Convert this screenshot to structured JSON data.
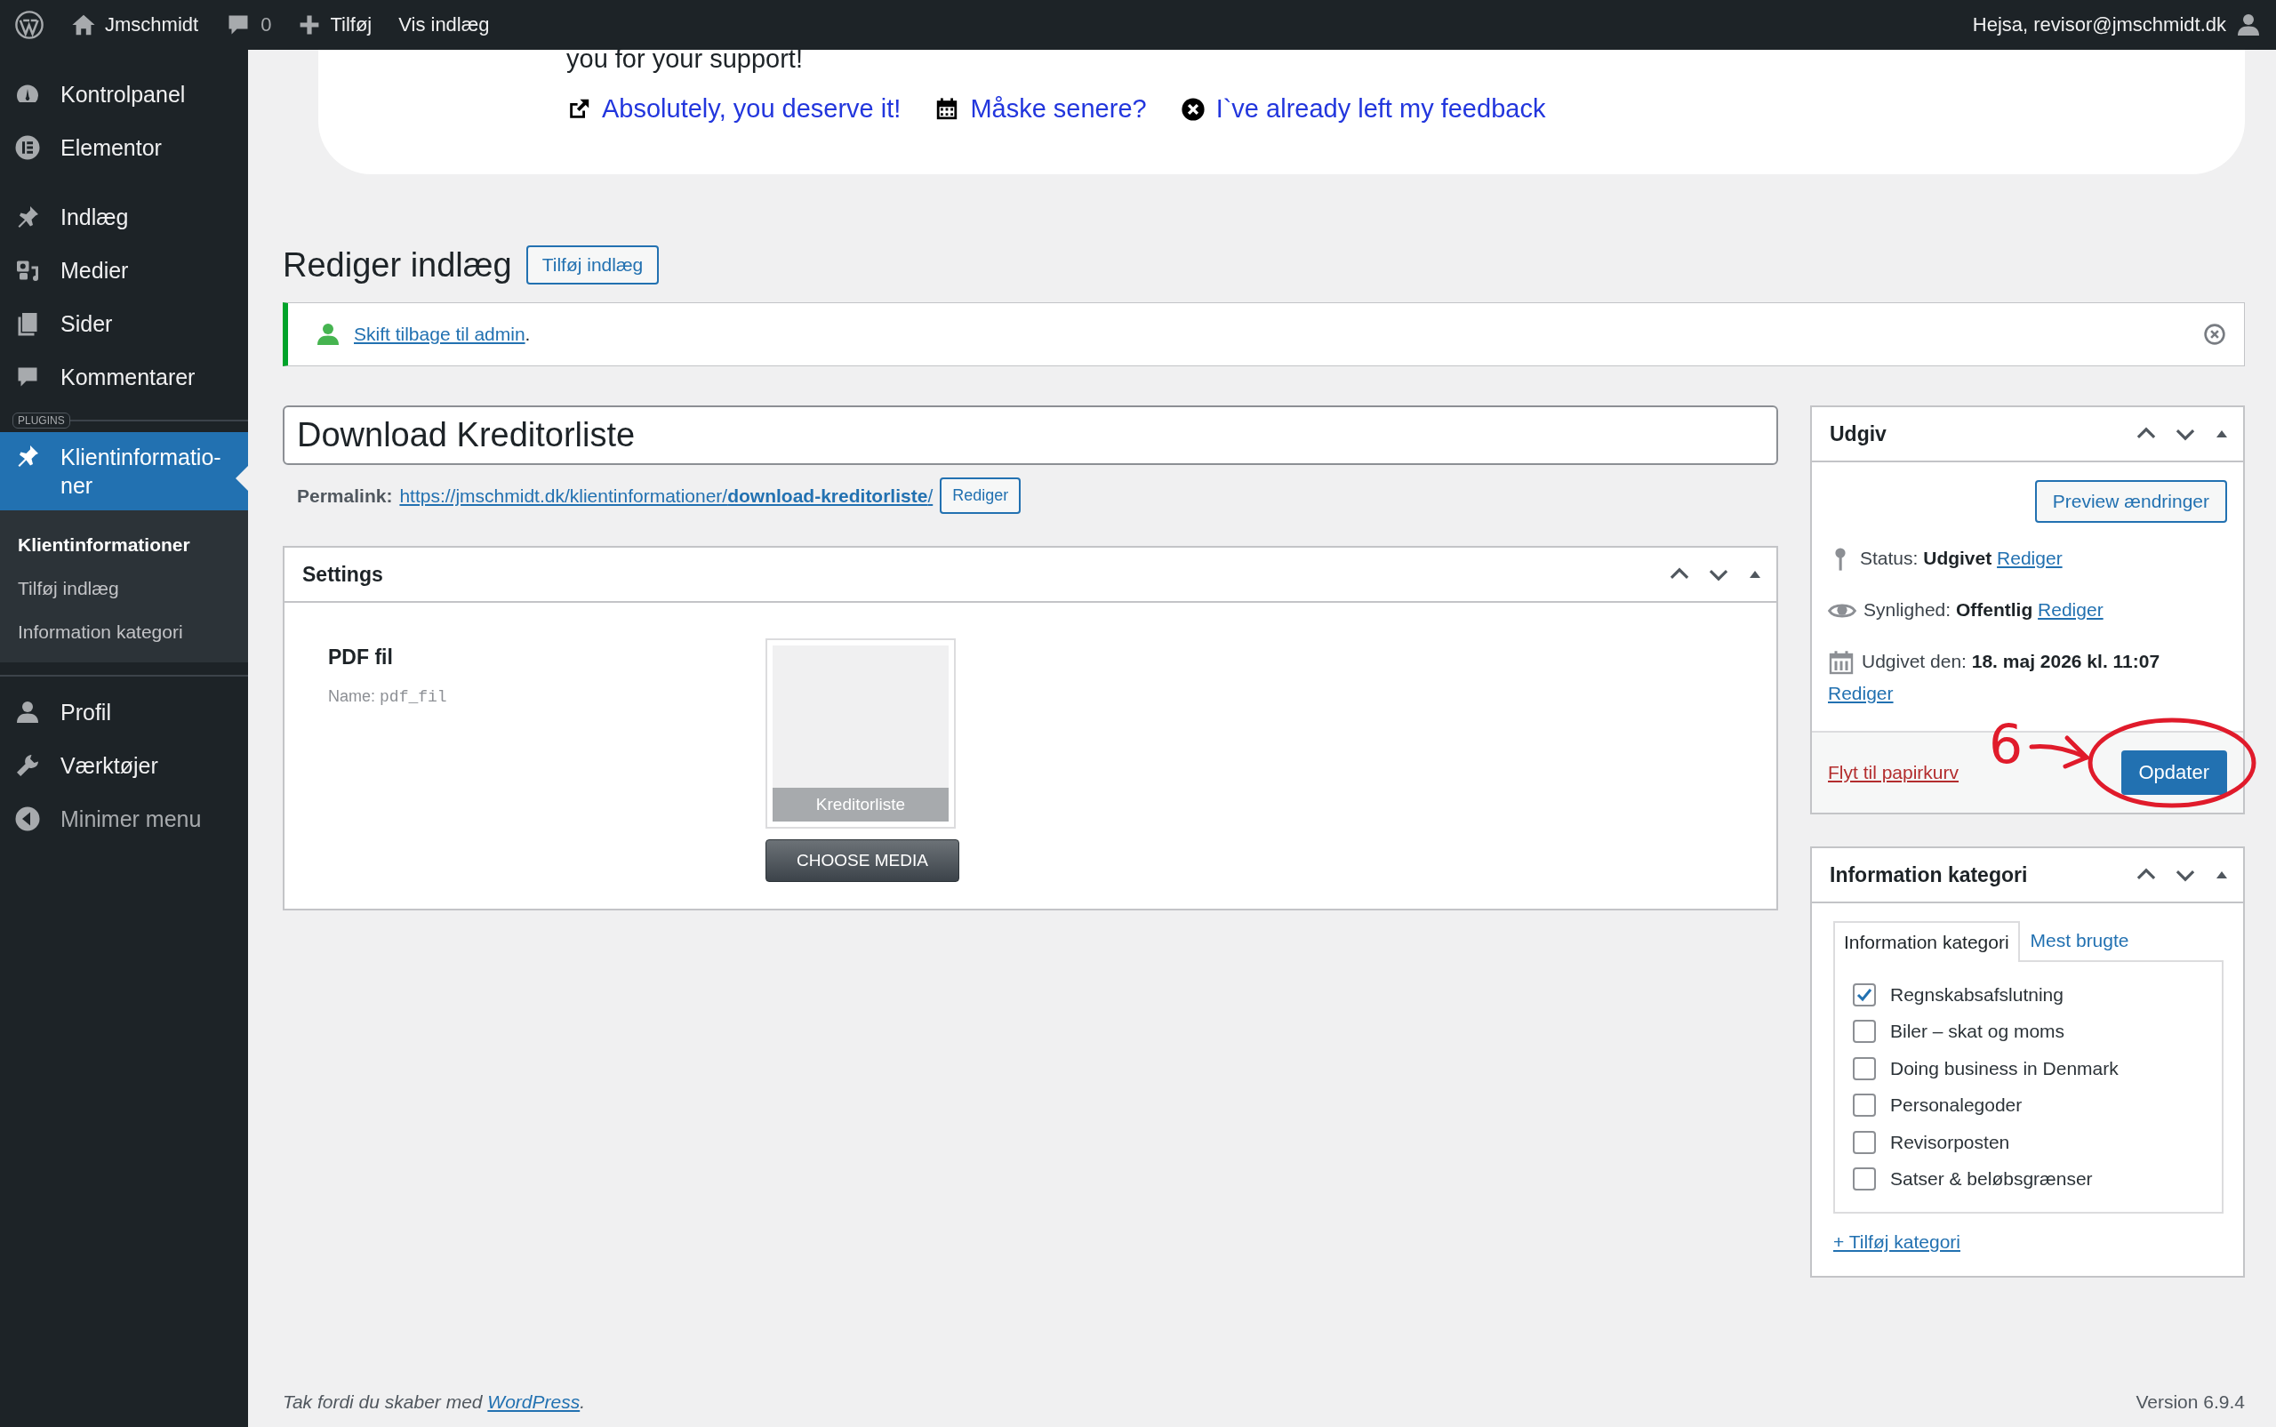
{
  "admin_bar": {
    "site": "Jmschmidt",
    "comments": "0",
    "new": "Tilføj",
    "view": "Vis indlæg",
    "greeting": "Hejsa, revisor@jmschmidt.dk"
  },
  "sidebar": {
    "items": [
      {
        "label": "Kontrolpanel",
        "selected": false
      },
      {
        "label": "Elementor",
        "selected": false
      },
      {
        "label": "Indlæg",
        "selected": false
      },
      {
        "label": "Medier",
        "selected": false
      },
      {
        "label": "Sider",
        "selected": false
      },
      {
        "label": "Kommentarer",
        "selected": false
      }
    ],
    "section_label": "PLUGINS",
    "plugin_items": [
      {
        "label": "Klientinformatio-ner",
        "selected": true
      }
    ],
    "submenu": [
      {
        "label": "Klientinformationer",
        "selected": true
      },
      {
        "label": "Tilføj indlæg",
        "selected": false
      },
      {
        "label": "Information kategori",
        "selected": false
      }
    ],
    "bottom_items": [
      {
        "label": "Profil",
        "selected": false
      },
      {
        "label": "Værktøjer",
        "selected": false
      },
      {
        "label": "Minimer menu",
        "selected": false
      }
    ]
  },
  "feedback_notice": {
    "text": "you for your support!",
    "links": [
      {
        "kind": "external",
        "label": "Absolutely, you deserve it!"
      },
      {
        "kind": "calendar",
        "label": "Måske senere?"
      },
      {
        "kind": "dismiss",
        "label": "I`ve already left my feedback"
      }
    ]
  },
  "page": {
    "title": "Rediger indlæg",
    "add_button": "Tilføj indlæg"
  },
  "admin_notice": {
    "link": "Skift tilbage til admin",
    "after": "."
  },
  "post_title": "Download Kreditorliste",
  "permalink": {
    "label": "Permalink:",
    "url": "https://jmschmidt.dk/klientinformationer/**download-kreditorliste**/",
    "button": "Rediger"
  },
  "settings": {
    "title": "Settings",
    "field_label": "PDF fil",
    "name_label": "Name:",
    "name_value": "pdf_fil",
    "media_caption": "Kreditorliste",
    "button": "CHOOSE MEDIA"
  },
  "publish": {
    "title": "Udgiv",
    "preview_button": "Preview ændringer",
    "rows": [
      {
        "kind": "status",
        "label": "Status:",
        "value": "Udgivet",
        "link": "Rediger"
      },
      {
        "kind": "visibility",
        "label": "Synlighed:",
        "value": "Offentlig",
        "link": "Rediger"
      },
      {
        "kind": "date",
        "label": "Udgivet den:",
        "value": "18. maj 2026 kl. 11:07",
        "link": "Rediger"
      }
    ],
    "trash_link": "Flyt til papirkurv",
    "update_button": "Opdater"
  },
  "categories": {
    "title": "Information kategori",
    "tabs": [
      {
        "label": "Information kategori",
        "selected": true
      },
      {
        "label": "Mest brugte",
        "selected": false
      }
    ],
    "items": [
      {
        "label": "Regnskabsafslutning",
        "checked": true
      },
      {
        "label": "Biler – skat og moms",
        "checked": false
      },
      {
        "label": "Doing business in Denmark",
        "checked": false
      },
      {
        "label": "Personalegoder",
        "checked": false
      },
      {
        "label": "Revisorposten",
        "checked": false
      },
      {
        "label": "Satser & beløbsgrænser",
        "checked": false
      }
    ],
    "add_link": "+ Tilføj kategori"
  },
  "annotation": {
    "label": "6"
  },
  "footer": {
    "text": "Tak fordi du skaber med ",
    "link": "WordPress",
    "after": ".",
    "version": "Version 6.9.4"
  }
}
